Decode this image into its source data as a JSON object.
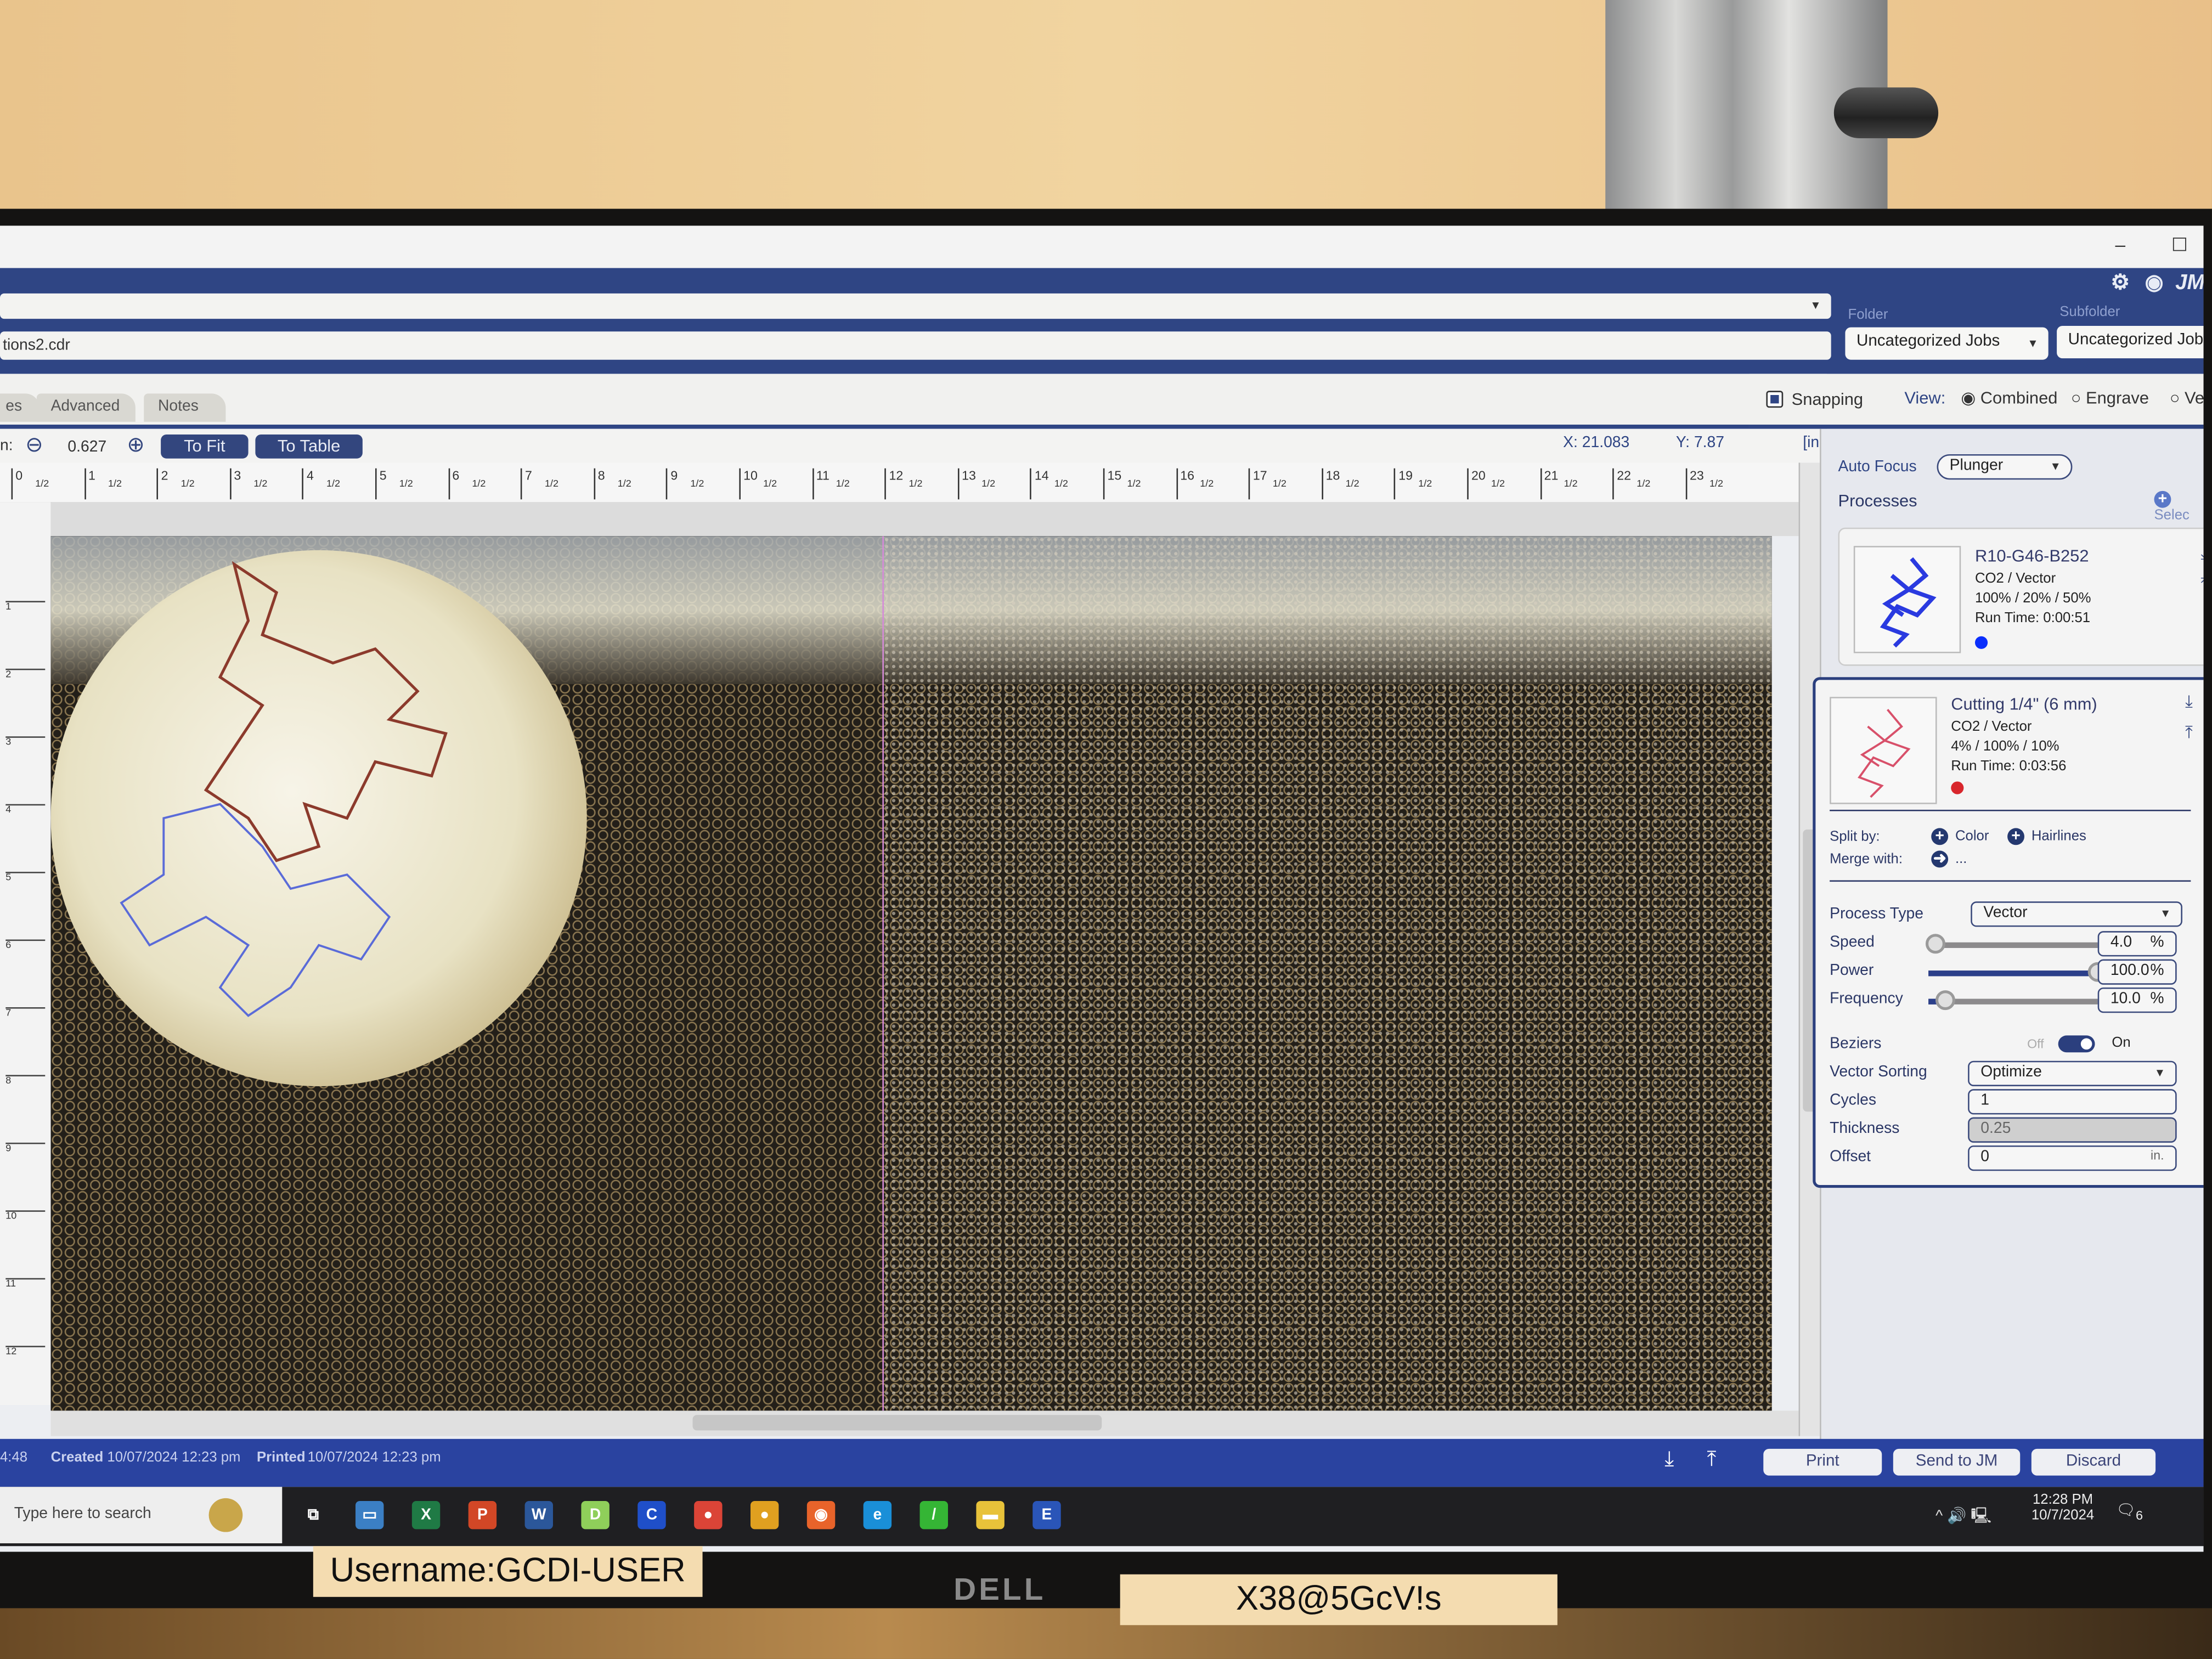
{
  "window": {
    "minimize_icon": "minimize-icon",
    "maximize_icon": "maximize-icon"
  },
  "header": {
    "filename_partial": "tions2.cdr",
    "folder_label": "Folder",
    "folder_value": "Uncategorized Jobs",
    "subfolder_label": "Subfolder",
    "subfolder_value": "Uncategorized Jobs",
    "icons": [
      "gear-icon",
      "pulse-icon",
      "jm-icon"
    ],
    "jm_logo": "JM"
  },
  "tabs": [
    {
      "label": "es"
    },
    {
      "label": "Advanced"
    },
    {
      "label": "Notes"
    }
  ],
  "view": {
    "snapping_label": "Snapping",
    "snapping_checked": true,
    "view_label": "View:",
    "options": [
      "Combined",
      "Engrave",
      "Ve"
    ],
    "selected": "Combined"
  },
  "toolbar": {
    "zoom_label": "n:",
    "zoom_value": "0.627",
    "to_fit": "To Fit",
    "to_table": "To Table",
    "x_label": "X:",
    "x_value": "21.083",
    "y_label": "Y:",
    "y_value": "7.87",
    "units": "[in.]"
  },
  "ruler": {
    "numbers": [
      "0",
      "1",
      "2",
      "3",
      "4",
      "5",
      "6",
      "7",
      "8",
      "9",
      "10",
      "11",
      "12",
      "13",
      "14",
      "15",
      "16",
      "17",
      "18",
      "19",
      "20",
      "21",
      "22",
      "23"
    ],
    "half": "1/2"
  },
  "vruler": {
    "numbers": [
      "1",
      "2",
      "3",
      "4",
      "5",
      "6",
      "7",
      "8",
      "9",
      "10",
      "11",
      "12"
    ],
    "half": "1/2"
  },
  "panel": {
    "auto_focus_label": "Auto Focus",
    "auto_focus_value": "Plunger",
    "processes_label": "Processes",
    "select_label": "Selec",
    "processes": [
      {
        "title": "R10-G46-B252",
        "type": "CO2 / Vector",
        "settings": "100% / 20% / 50%",
        "run_time": "Run Time: 0:00:51",
        "color": "#0a2efc"
      },
      {
        "title": "Cutting 1/4\" (6 mm)",
        "type": "CO2 / Vector",
        "settings": "4% / 100% / 10%",
        "run_time": "Run Time: 0:03:56",
        "color": "#d8262c"
      }
    ],
    "split_by_label": "Split by:",
    "split_color": "Color",
    "split_hairlines": "Hairlines",
    "merge_with_label": "Merge with:",
    "merge_value": "...",
    "process_type_label": "Process Type",
    "process_type_value": "Vector",
    "speed_label": "Speed",
    "speed_value": "4.0",
    "speed_pct": 4,
    "power_label": "Power",
    "power_value": "100.0",
    "power_pct": 100,
    "frequency_label": "Frequency",
    "frequency_value": "10.0",
    "frequency_pct": 10,
    "percent": "%",
    "beziers_label": "Beziers",
    "beziers_off": "Off",
    "beziers_on": "On",
    "beziers_enabled": true,
    "vector_sorting_label": "Vector Sorting",
    "vector_sorting_value": "Optimize",
    "cycles_label": "Cycles",
    "cycles_value": "1",
    "thickness_label": "Thickness",
    "thickness_value": "0.25",
    "offset_label": "Offset",
    "offset_value": "0",
    "offset_unit": "in."
  },
  "status": {
    "partial": "4:48",
    "created_label": "Created",
    "created_value": "10/07/2024 12:23 pm",
    "printed_label": "Printed",
    "printed_value": "10/07/2024 12:23 pm"
  },
  "actions": {
    "print": "Print",
    "send": "Send to JM",
    "discard": "Discard"
  },
  "taskbar": {
    "search_placeholder": "Type here to search",
    "apps": [
      {
        "name": "task-view-icon",
        "glyph": "⧉",
        "color": "#1f1f22"
      },
      {
        "name": "laptop-app-icon",
        "glyph": "▭",
        "color": "#3b7fc4"
      },
      {
        "name": "excel-icon",
        "glyph": "X",
        "color": "#1f7a45"
      },
      {
        "name": "powerpoint-icon",
        "glyph": "P",
        "color": "#d24726"
      },
      {
        "name": "word-icon",
        "glyph": "W",
        "color": "#2b579a"
      },
      {
        "name": "d-app-icon",
        "glyph": "D",
        "color": "#8fcf5a"
      },
      {
        "name": "c-app-icon",
        "glyph": "C",
        "color": "#1f4fc9"
      },
      {
        "name": "chrome-icon",
        "glyph": "●",
        "color": "#db4437"
      },
      {
        "name": "chrome-icon-2",
        "glyph": "●",
        "color": "#e0a020"
      },
      {
        "name": "firefox-icon",
        "glyph": "◉",
        "color": "#e8632a"
      },
      {
        "name": "edge-icon",
        "glyph": "e",
        "color": "#1a8fd8"
      },
      {
        "name": "green-app-icon",
        "glyph": "/",
        "color": "#35b535"
      },
      {
        "name": "file-explorer-icon",
        "glyph": "▬",
        "color": "#e8c23a"
      },
      {
        "name": "job-manager-icon",
        "glyph": "E",
        "color": "#2a55b8"
      }
    ],
    "time": "12:28 PM",
    "date": "10/7/2024",
    "notifications": "6"
  },
  "monitor": {
    "brand": "DELL",
    "sticker_username": "Username:GCDI-USER",
    "sticker_password": "X38@5GcV!s"
  }
}
